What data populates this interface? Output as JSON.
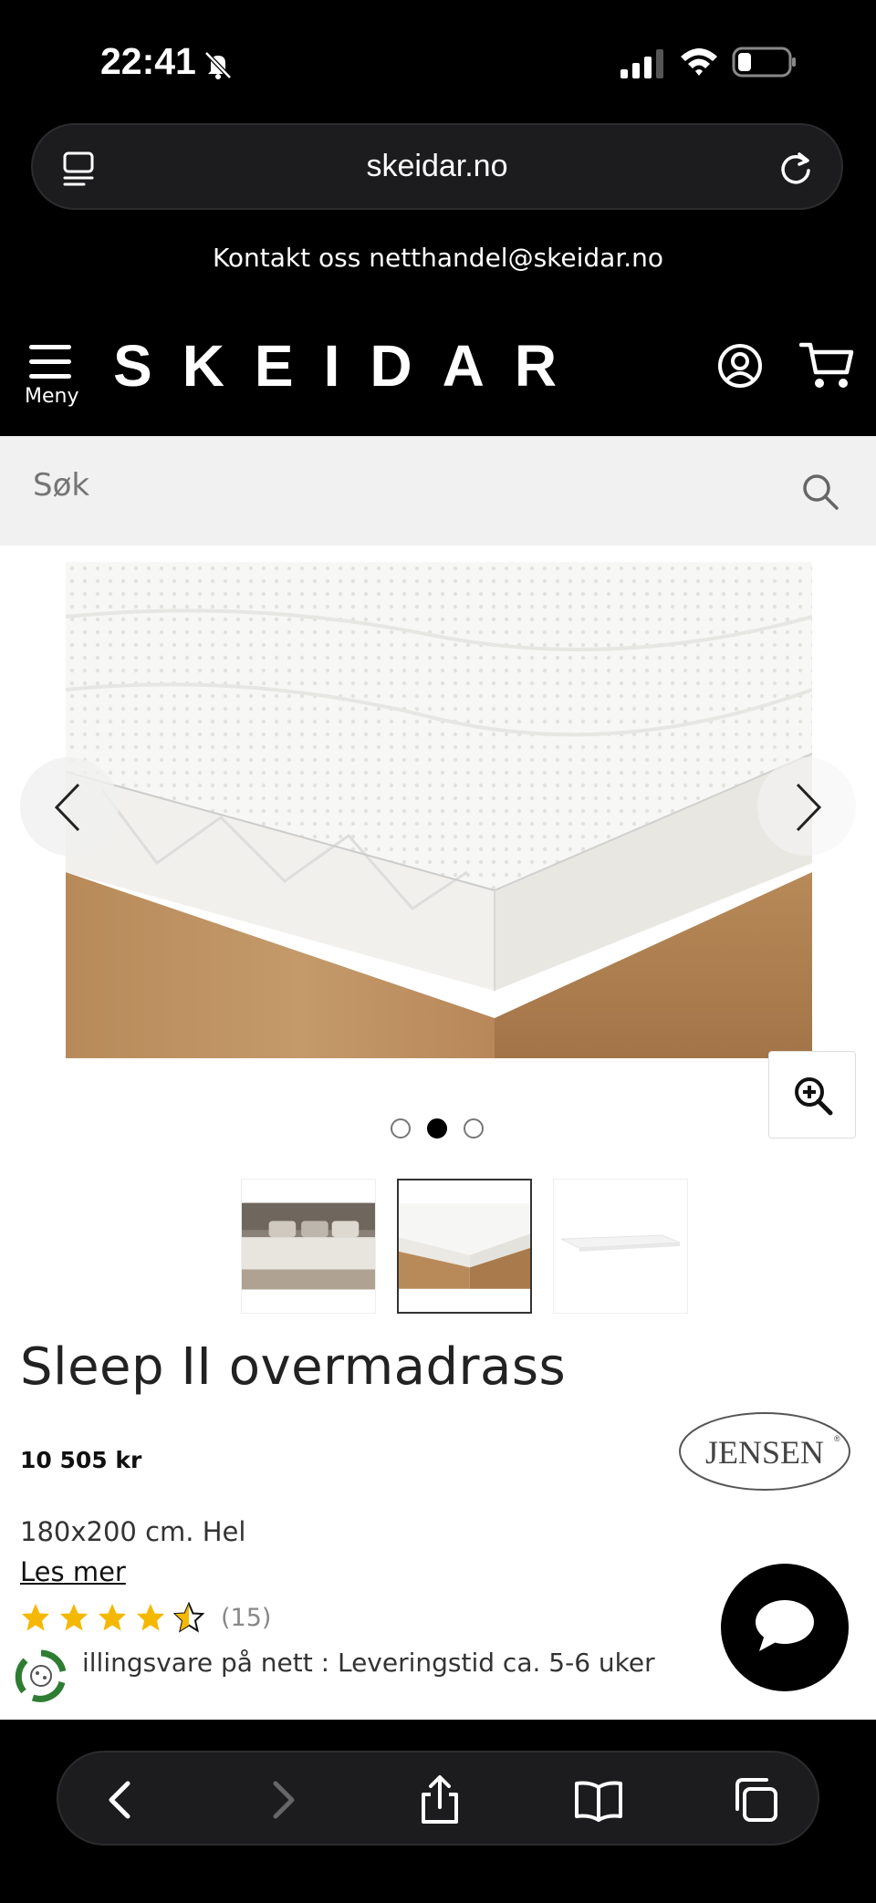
{
  "status_bar": {
    "time": "22:41"
  },
  "browser": {
    "url": "skeidar.no"
  },
  "header": {
    "contact": "Kontakt oss netthandel@skeidar.no",
    "menu_label": "Meny",
    "logo": "SKEIDAR"
  },
  "search": {
    "placeholder": "Søk"
  },
  "gallery": {
    "active_index": 1,
    "count": 3
  },
  "product": {
    "title": "Sleep II overmadrass",
    "price": "10 505 kr",
    "brand": "JENSEN",
    "size": "180x200 cm. Hel",
    "read_more": "Les mer",
    "rating": 4.5,
    "review_count": "(15)",
    "delivery": "illingsvare på nett : Leveringstid ca. 5-6 uker"
  },
  "colors": {
    "accent_star": "#f5b800",
    "eco_green": "#2e7d32"
  }
}
